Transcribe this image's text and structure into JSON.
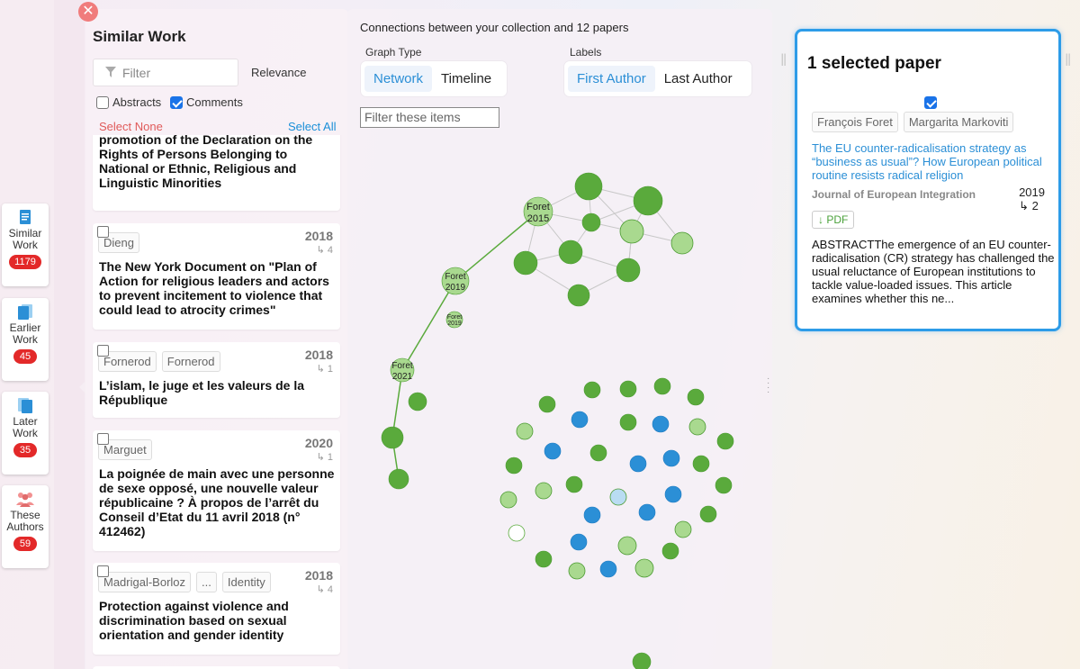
{
  "sidebar": {
    "tabs": [
      {
        "line1": "Similar",
        "line2": "Work",
        "count": "1179"
      },
      {
        "line1": "Earlier",
        "line2": "Work",
        "count": "45"
      },
      {
        "line1": "Later",
        "line2": "Work",
        "count": "35"
      },
      {
        "line1": "These",
        "line2": "Authors",
        "count": "59"
      }
    ]
  },
  "list_panel": {
    "title": "Similar Work",
    "filter_placeholder": "Filter",
    "sort": "Relevance",
    "abstracts_label": "Abstracts",
    "comments_label": "Comments",
    "select_none": "Select None",
    "select_all": "Select All",
    "cards": [
      {
        "authors": [],
        "year": "",
        "cites": "",
        "title": "promotion of the Declaration on the Rights of Persons Belonging to National or Ethnic, Religious and Linguistic Minorities"
      },
      {
        "authors": [
          "Dieng"
        ],
        "year": "2018",
        "cites": "↳ 4",
        "title": "The New York Document on \"Plan of Action for religious leaders and actors to prevent incitement to violence that could lead to atrocity crimes\""
      },
      {
        "authors": [
          "Fornerod",
          "Fornerod"
        ],
        "year": "2018",
        "cites": "↳ 1",
        "title": "L’islam, le juge et les valeurs de la République"
      },
      {
        "authors": [
          "Marguet"
        ],
        "year": "2020",
        "cites": "↳ 1",
        "title": "La poignée de main avec une personne de sexe opposé, une nouvelle valeur républicaine ? À propos de l’arrêt du Conseil d’Etat du 11 avril 2018 (n° 412462)"
      },
      {
        "authors": [
          "Madrigal-Borloz",
          "...",
          "Identity"
        ],
        "year": "2018",
        "cites": "↳ 4",
        "title": "Protection against violence and discrimination based on sexual orientation and gender identity"
      }
    ]
  },
  "graph": {
    "heading": "Connections between your collection and 12 papers",
    "graph_type_label": "Graph Type",
    "graph_types": [
      "Network",
      "Timeline"
    ],
    "labels_label": "Labels",
    "label_options": [
      "First Author",
      "Last Author"
    ],
    "filter_placeholder": "Filter these items",
    "node_labels": [
      {
        "name": "Foret",
        "year": "2015"
      },
      {
        "name": "Foret",
        "year": "2019"
      },
      {
        "name": "Foret",
        "year": "2019"
      },
      {
        "name": "Foret",
        "year": "2021"
      }
    ],
    "colors": {
      "green": "#5aaa3c",
      "light_green": "#a9d98f",
      "blue": "#2b8fd6",
      "light_blue": "#b9dcf2"
    }
  },
  "selected": {
    "title": "1 selected paper",
    "authors": [
      "François Foret",
      "Margarita Markoviti"
    ],
    "paper_title": "The EU counter-radicalisation strategy as “business as usual”? How European political routine resists radical religion",
    "journal": "Journal of European Integration",
    "year": "2019",
    "cites": "↳ 2",
    "pdf": "↓ PDF",
    "abstract": "ABSTRACTThe emergence of an EU counter-radicalisation (CR) strategy has challenged the usual reluctance of European institutions to tackle value-loaded issues. This article examines whether this ne..."
  }
}
